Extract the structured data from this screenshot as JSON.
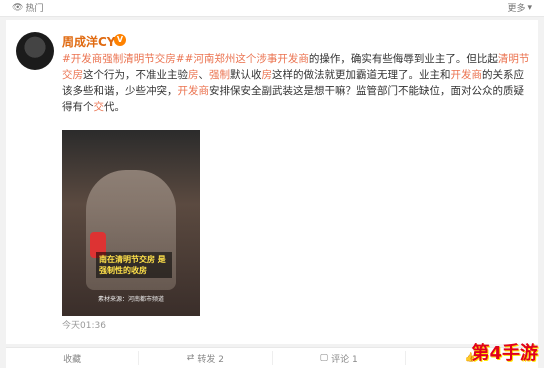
{
  "topbar": {
    "tag": "热门",
    "more": "更多"
  },
  "post": {
    "username": "周成洋CY",
    "verified": "V",
    "text_parts": [
      {
        "t": "#开发商强制清明节交房#",
        "c": "hl"
      },
      {
        "t": "#河南郑州这个涉事",
        "c": "hl"
      },
      {
        "t": "开发商",
        "c": "kw"
      },
      {
        "t": "的操作，确实有些侮辱到业主了。但比起",
        "c": ""
      },
      {
        "t": "清明节交房",
        "c": "kw"
      },
      {
        "t": "这个行为，不准业主验",
        "c": ""
      },
      {
        "t": "房",
        "c": "kw"
      },
      {
        "t": "、",
        "c": ""
      },
      {
        "t": "强制",
        "c": "kw"
      },
      {
        "t": "默认收",
        "c": ""
      },
      {
        "t": "房",
        "c": "kw"
      },
      {
        "t": "这样的做法就更加霸道无理了。业主和",
        "c": ""
      },
      {
        "t": "开发商",
        "c": "kw"
      },
      {
        "t": "的关系应该多些和谐，少些冲突，",
        "c": ""
      },
      {
        "t": "开发商",
        "c": "kw"
      },
      {
        "t": "安排保安全副武装这是想干嘛？监管部门不能缺位，面对公众的质疑得有个",
        "c": ""
      },
      {
        "t": "交",
        "c": "kw"
      },
      {
        "t": "代。",
        "c": ""
      }
    ],
    "video_caption": "南在清明节交房 是强制性的收房",
    "video_source": "素材来源：河南都市频道",
    "time": "今天01:36"
  },
  "actions": {
    "favorite": "收藏",
    "repost": "转发 2",
    "comment": "评论 1",
    "like": ""
  },
  "watermark": "第4手游",
  "colors": {
    "accent": "#eb7350",
    "username": "#e06a10"
  }
}
